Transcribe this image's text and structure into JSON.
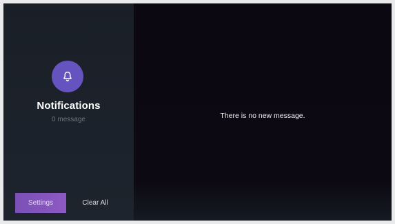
{
  "notifications": {
    "title": "Notifications",
    "count_text": "0 message",
    "icon": "bell-icon"
  },
  "actions": {
    "settings_label": "Settings",
    "clear_all_label": "Clear All"
  },
  "content": {
    "empty_text": "There is no new message."
  },
  "colors": {
    "accent": "#6554c0",
    "settings_button": "#8755bd",
    "sidebar_bg": "#1b2029",
    "content_bg": "#0c0812"
  }
}
